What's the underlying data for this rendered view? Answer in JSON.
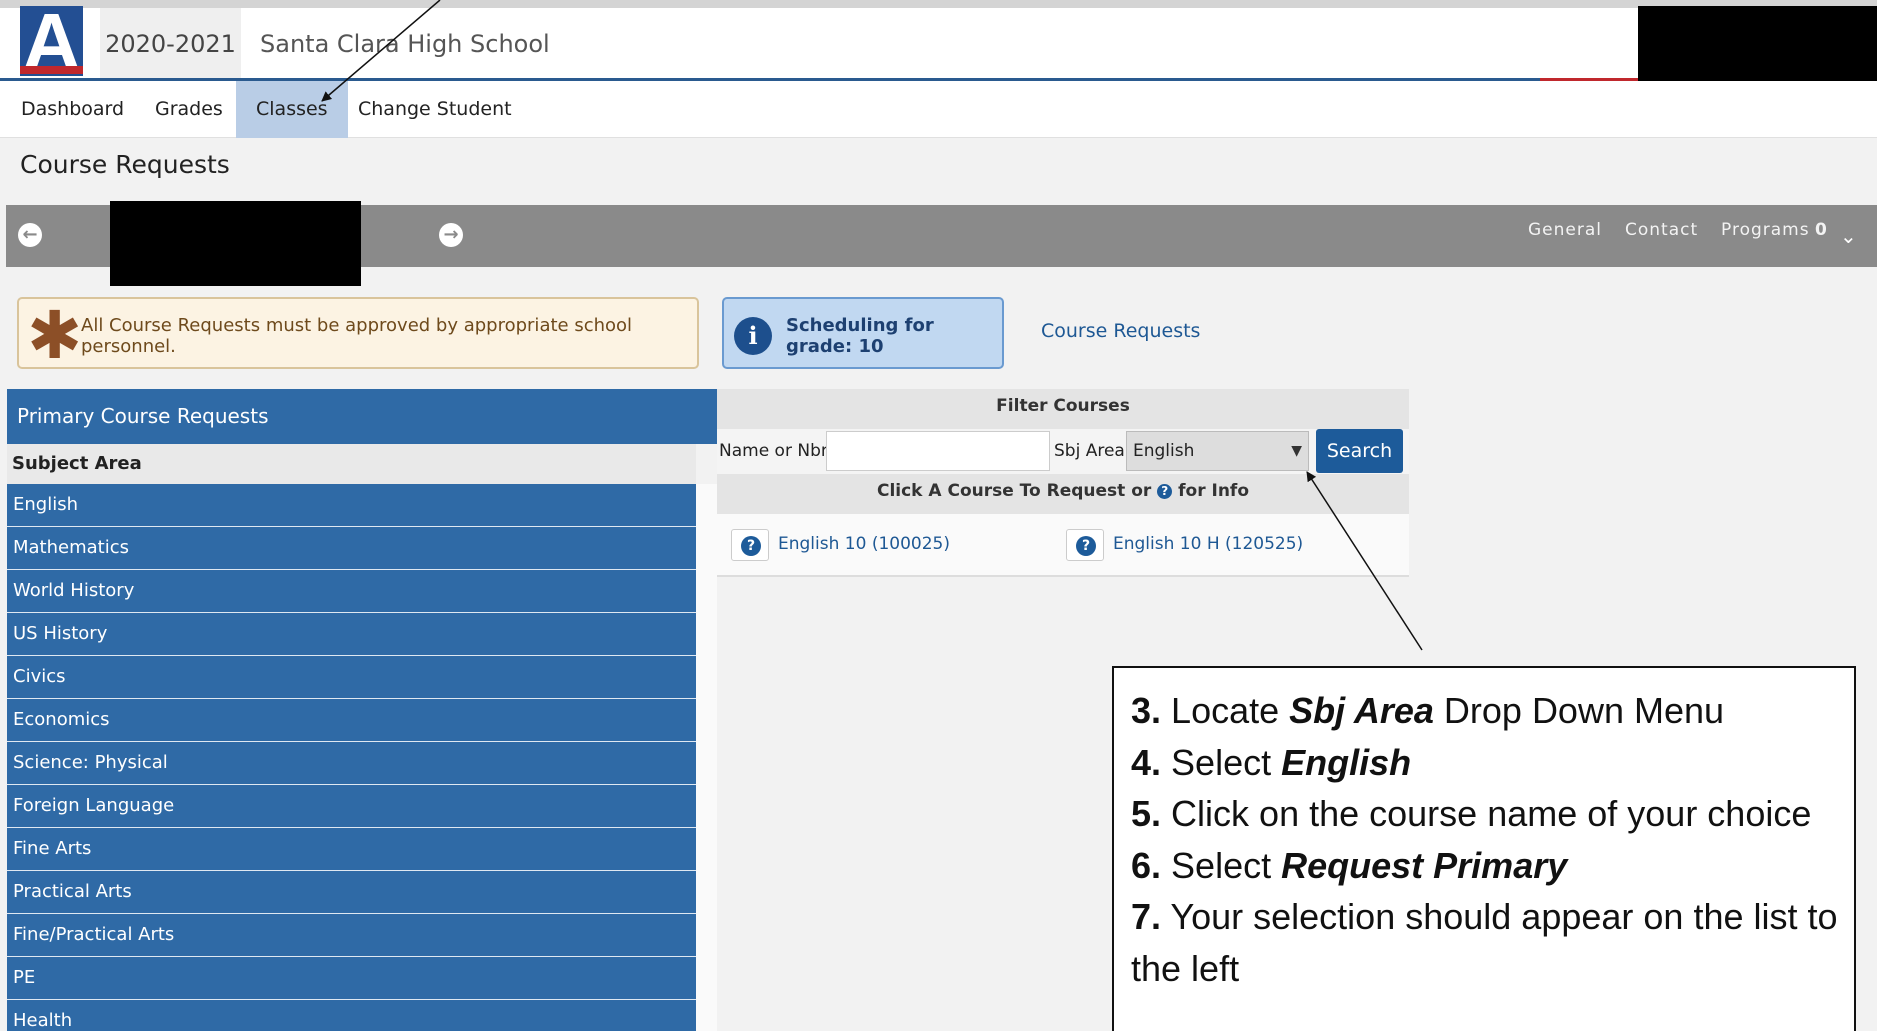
{
  "header": {
    "logo_letter": "A",
    "year": "2020-2021",
    "school": "Santa Clara High School"
  },
  "nav": {
    "items": [
      {
        "label": "Dashboard"
      },
      {
        "label": "Grades"
      },
      {
        "label": "Classes",
        "active": true
      },
      {
        "label": "Change Student"
      }
    ]
  },
  "page": {
    "title": "Course Requests"
  },
  "student_bar": {
    "links": [
      "General",
      "Contact",
      "Programs"
    ],
    "programs_count": "0"
  },
  "notice": {
    "text": "All Course Requests must be approved by appropriate school personnel."
  },
  "info": {
    "text": "Scheduling for grade: 10",
    "link": "Course Requests"
  },
  "primary": {
    "heading": "Primary Course Requests",
    "subject_header": "Subject Area",
    "subjects": [
      "English",
      "Mathematics",
      "World History",
      "US History",
      "Civics",
      "Economics",
      "Science: Physical",
      "Foreign Language",
      "Fine Arts",
      "Practical Arts",
      "Fine/Practical Arts",
      "PE",
      "Health"
    ]
  },
  "filter": {
    "heading": "Filter Courses",
    "name_label": "Name or Nbr:",
    "name_value": "",
    "sbj_label": "Sbj Area:",
    "sbj_value": "English",
    "search_label": "Search",
    "click_prefix": "Click A Course To Request or",
    "click_suffix": "for Info",
    "courses": [
      "English 10 (100025)",
      "English 10 H (120525)"
    ]
  },
  "instructions": [
    {
      "num": "3.",
      "pre": "Locate",
      "bold": "Sbj Area",
      "post": "Drop Down Menu"
    },
    {
      "num": "4.",
      "pre": "Select",
      "bold": "English",
      "post": ""
    },
    {
      "num": "5.",
      "pre": "Click on the course name of your choice",
      "bold": "",
      "post": ""
    },
    {
      "num": "6.",
      "pre": "Select",
      "bold": "Request Primary",
      "post": ""
    },
    {
      "num": "7.",
      "pre": "Your selection should appear on the list to the left",
      "bold": "",
      "post": ""
    }
  ],
  "colors": {
    "brand_blue": "#2f6aa6",
    "nav_active": "#b9cde6",
    "bar_grey": "#8a8a8a",
    "accent_red": "#c0282d"
  }
}
